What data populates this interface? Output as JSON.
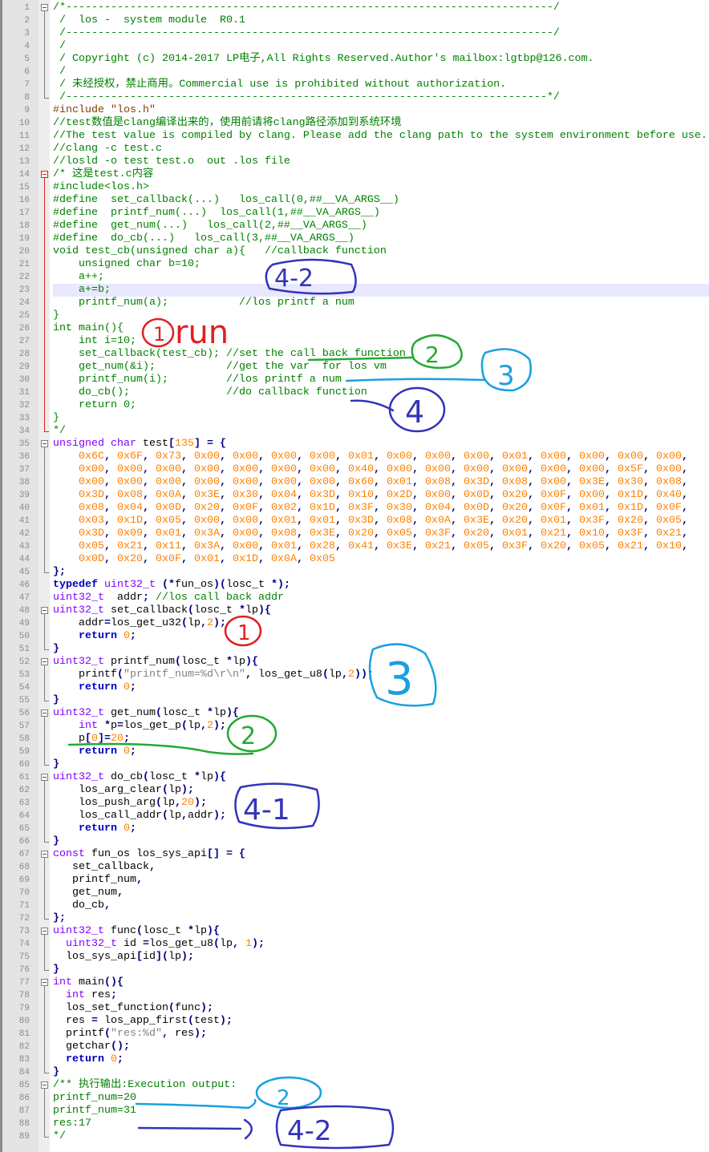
{
  "editor": {
    "current_line": 23,
    "folds": [
      [
        1,
        8,
        false
      ],
      [
        14,
        34,
        true
      ],
      [
        35,
        45,
        false
      ],
      [
        48,
        51,
        false
      ],
      [
        52,
        55,
        false
      ],
      [
        56,
        60,
        false
      ],
      [
        61,
        66,
        false
      ],
      [
        67,
        72,
        false
      ],
      [
        73,
        76,
        false
      ],
      [
        77,
        84,
        false
      ],
      [
        85,
        89,
        false
      ]
    ],
    "colors": {
      "comment": "#008000",
      "keyword": "#0000c0",
      "type": "#8000ff",
      "number": "#ff8000",
      "string": "#808080",
      "preprocessor": "#804000",
      "operator": "#000080",
      "current_line": "#e8e8ff"
    },
    "lines": [
      [
        [
          "c",
          "/*----------------------------------------------------------------------------/"
        ]
      ],
      [
        [
          "c",
          " /  los -  system module  R0.1"
        ]
      ],
      [
        [
          "c",
          " /----------------------------------------------------------------------------/"
        ]
      ],
      [
        [
          "c",
          " /"
        ]
      ],
      [
        [
          "c",
          " / Copyright (c) 2014-2017 LP电子,All Rights Reserved.Author's mailbox:lgtbp@126.com."
        ]
      ],
      [
        [
          "c",
          " /"
        ]
      ],
      [
        [
          "c",
          " / 未经授权，禁止商用。Commercial use is prohibited without authorization."
        ]
      ],
      [
        [
          "c",
          " /---------------------------------------------------------------------------*/"
        ]
      ],
      [
        [
          "p",
          "#include \"los.h\""
        ]
      ],
      [
        [
          "c",
          "//test数值是clang编译出来的，使用前请将clang路径添加到系统环境"
        ]
      ],
      [
        [
          "c",
          "//The test value is compiled by clang. Please add the clang path to the system environment before use."
        ]
      ],
      [
        [
          "c",
          "//clang -c test.c"
        ]
      ],
      [
        [
          "c",
          "//losld -o test test.o  out .los file"
        ]
      ],
      [
        [
          "c",
          "/* 这是test.c内容"
        ]
      ],
      [
        [
          "c",
          "#include<los.h>"
        ]
      ],
      [
        [
          "c",
          "#define  set_callback(...)   los_call(0,##__VA_ARGS__)"
        ]
      ],
      [
        [
          "c",
          "#define  printf_num(...)  los_call(1,##__VA_ARGS__)"
        ]
      ],
      [
        [
          "c",
          "#define  get_num(...)   los_call(2,##__VA_ARGS__)"
        ]
      ],
      [
        [
          "c",
          "#define  do_cb(...)   los_call(3,##__VA_ARGS__)"
        ]
      ],
      [
        [
          "c",
          "void test_cb(unsigned char a){   //callback function"
        ]
      ],
      [
        [
          "c",
          "    unsigned char b=10;"
        ]
      ],
      [
        [
          "c",
          "    a++;"
        ]
      ],
      [
        [
          "c",
          "    a+=b;"
        ]
      ],
      [
        [
          "c",
          "    printf_num(a);           //los printf a num"
        ]
      ],
      [
        [
          "c",
          "}"
        ]
      ],
      [
        [
          "c",
          "int main(){"
        ]
      ],
      [
        [
          "c",
          "    int i=10;"
        ]
      ],
      [
        [
          "c",
          "    set_callback(test_cb); //set the call back function"
        ]
      ],
      [
        [
          "c",
          "    get_num(&i);           //get the var  for los vm"
        ]
      ],
      [
        [
          "c",
          "    printf_num(i);         //los printf a num"
        ]
      ],
      [
        [
          "c",
          "    do_cb();               //do callback function"
        ]
      ],
      [
        [
          "c",
          "    return 0;"
        ]
      ],
      [
        [
          "c",
          "}"
        ]
      ],
      [
        [
          "c",
          "*/"
        ]
      ],
      [
        [
          "t",
          "unsigned char"
        ],
        [
          "x",
          " test["
        ],
        [
          "n",
          "135"
        ],
        [
          "x",
          "] = {"
        ]
      ],
      [
        [
          "hex",
          "0x6C,0x6F,0x73,0x00,0x00,0x00,0x00,0x01,0x00,0x00,0x00,0x01,0x00,0x00,0x00,0x00"
        ]
      ],
      [
        [
          "hex",
          "0x00,0x00,0x00,0x00,0x00,0x00,0x00,0x40,0x00,0x00,0x00,0x00,0x00,0x00,0x5F,0x00"
        ]
      ],
      [
        [
          "hex",
          "0x00,0x00,0x00,0x00,0x00,0x00,0x00,0x60,0x01,0x08,0x3D,0x08,0x00,0x3E,0x30,0x08"
        ]
      ],
      [
        [
          "hex",
          "0x3D,0x08,0x0A,0x3E,0x30,0x04,0x3D,0x10,0x2D,0x00,0x0D,0x20,0x0F,0x00,0x1D,0x40"
        ]
      ],
      [
        [
          "hex",
          "0x08,0x04,0x0D,0x20,0x0F,0x02,0x1D,0x3F,0x30,0x04,0x0D,0x20,0x0F,0x01,0x1D,0x0F"
        ]
      ],
      [
        [
          "hex",
          "0x03,0x1D,0x05,0x00,0x00,0x01,0x01,0x3D,0x08,0x0A,0x3E,0x20,0x01,0x3F,0x20,0x05"
        ]
      ],
      [
        [
          "hex",
          "0x3D,0x09,0x01,0x3A,0x00,0x08,0x3E,0x20,0x05,0x3F,0x20,0x01,0x21,0x10,0x3F,0x21"
        ]
      ],
      [
        [
          "hex",
          "0x05,0x21,0x11,0x3A,0x00,0x01,0x28,0x41,0x3E,0x21,0x05,0x3F,0x20,0x05,0x21,0x10"
        ]
      ],
      [
        [
          "hexlast",
          "0x0D,0x20,0x0F,0x01,0x1D,0x0A,0x05"
        ]
      ],
      [
        [
          "x",
          "};"
        ]
      ],
      [
        [
          "k",
          "typedef"
        ],
        [
          "x",
          " "
        ],
        [
          "t",
          "uint32_t"
        ],
        [
          "x",
          " (*fun_os)(losc_t *);"
        ]
      ],
      [
        [
          "t",
          "uint32_t"
        ],
        [
          "x",
          "  addr; "
        ],
        [
          "c",
          "//los call back addr"
        ]
      ],
      [
        [
          "t",
          "uint32_t"
        ],
        [
          "x",
          " set_callback(losc_t *lp){"
        ]
      ],
      [
        [
          "x",
          "    addr=los_get_u32(lp,"
        ],
        [
          "n",
          "2"
        ],
        [
          "x",
          ");"
        ]
      ],
      [
        [
          "x",
          "    "
        ],
        [
          "k",
          "return"
        ],
        [
          "x",
          " "
        ],
        [
          "n",
          "0"
        ],
        [
          "x",
          ";"
        ]
      ],
      [
        [
          "x",
          "}"
        ]
      ],
      [
        [
          "t",
          "uint32_t"
        ],
        [
          "x",
          " printf_num(losc_t *lp){"
        ]
      ],
      [
        [
          "x",
          "    printf("
        ],
        [
          "s",
          "\"printf_num=%d\\r\\n\""
        ],
        [
          "x",
          ", los_get_u8(lp,"
        ],
        [
          "n",
          "2"
        ],
        [
          "x",
          "));"
        ]
      ],
      [
        [
          "x",
          "    "
        ],
        [
          "k",
          "return"
        ],
        [
          "x",
          " "
        ],
        [
          "n",
          "0"
        ],
        [
          "x",
          ";"
        ]
      ],
      [
        [
          "x",
          "}"
        ]
      ],
      [
        [
          "t",
          "uint32_t"
        ],
        [
          "x",
          " get_num(losc_t *lp){"
        ]
      ],
      [
        [
          "x",
          "    "
        ],
        [
          "t",
          "int"
        ],
        [
          "x",
          " *p=los_get_p(lp,"
        ],
        [
          "n",
          "2"
        ],
        [
          "x",
          ");"
        ]
      ],
      [
        [
          "x",
          "    p["
        ],
        [
          "n",
          "0"
        ],
        [
          "x",
          "]="
        ],
        [
          "n",
          "20"
        ],
        [
          "x",
          ";"
        ]
      ],
      [
        [
          "x",
          "    "
        ],
        [
          "k",
          "return"
        ],
        [
          "x",
          " "
        ],
        [
          "n",
          "0"
        ],
        [
          "x",
          ";"
        ]
      ],
      [
        [
          "x",
          "}"
        ]
      ],
      [
        [
          "t",
          "uint32_t"
        ],
        [
          "x",
          " do_cb(losc_t *lp){"
        ]
      ],
      [
        [
          "x",
          "    los_arg_clear(lp);"
        ]
      ],
      [
        [
          "x",
          "    los_push_arg(lp,"
        ],
        [
          "n",
          "20"
        ],
        [
          "x",
          ");"
        ]
      ],
      [
        [
          "x",
          "    los_call_addr(lp,addr);"
        ]
      ],
      [
        [
          "x",
          "    "
        ],
        [
          "k",
          "return"
        ],
        [
          "x",
          " "
        ],
        [
          "n",
          "0"
        ],
        [
          "x",
          ";"
        ]
      ],
      [
        [
          "x",
          "}"
        ]
      ],
      [
        [
          "t",
          "const"
        ],
        [
          "x",
          " fun_os los_sys_api[] = {"
        ]
      ],
      [
        [
          "x",
          "   set_callback,"
        ]
      ],
      [
        [
          "x",
          "   printf_num,"
        ]
      ],
      [
        [
          "x",
          "   get_num,"
        ]
      ],
      [
        [
          "x",
          "   do_cb,"
        ]
      ],
      [
        [
          "x",
          "};"
        ]
      ],
      [
        [
          "t",
          "uint32_t"
        ],
        [
          "x",
          " func(losc_t *lp){"
        ]
      ],
      [
        [
          "x",
          "  "
        ],
        [
          "t",
          "uint32_t"
        ],
        [
          "x",
          " id =los_get_u8(lp, "
        ],
        [
          "n",
          "1"
        ],
        [
          "x",
          ");"
        ]
      ],
      [
        [
          "x",
          "  los_sys_api[id](lp);"
        ]
      ],
      [
        [
          "x",
          "}"
        ]
      ],
      [
        [
          "t",
          "int"
        ],
        [
          "x",
          " main(){"
        ]
      ],
      [
        [
          "x",
          "  "
        ],
        [
          "t",
          "int"
        ],
        [
          "x",
          " res;"
        ]
      ],
      [
        [
          "x",
          "  los_set_function(func);"
        ]
      ],
      [
        [
          "x",
          "  res = los_app_first(test);"
        ]
      ],
      [
        [
          "x",
          "  printf("
        ],
        [
          "s",
          "\"res:%d\""
        ],
        [
          "x",
          ", res);"
        ]
      ],
      [
        [
          "x",
          "  getchar();"
        ]
      ],
      [
        [
          "x",
          "  "
        ],
        [
          "k",
          "return"
        ],
        [
          "x",
          " "
        ],
        [
          "n",
          "0"
        ],
        [
          "x",
          ";"
        ]
      ],
      [
        [
          "x",
          "}"
        ]
      ],
      [
        [
          "c",
          "/** 执行输出:Execution output:"
        ]
      ],
      [
        [
          "c",
          "printf_num=20"
        ]
      ],
      [
        [
          "c",
          "printf_num=31"
        ]
      ],
      [
        [
          "c",
          "res:17"
        ]
      ],
      [
        [
          "c",
          "*/"
        ]
      ]
    ]
  },
  "annotations": {
    "colors": {
      "red": "#e02020",
      "green": "#22aa33",
      "cyan": "#1aa0e0",
      "blue": "#3333bb"
    },
    "a1": "4-2",
    "a2": "1",
    "a3": "run",
    "a4": "2",
    "a5": "3",
    "a6": "4",
    "a7": "1",
    "a8": "3",
    "a9": "2",
    "a10": "4-1",
    "a11": "2",
    "a12": "4-2"
  }
}
